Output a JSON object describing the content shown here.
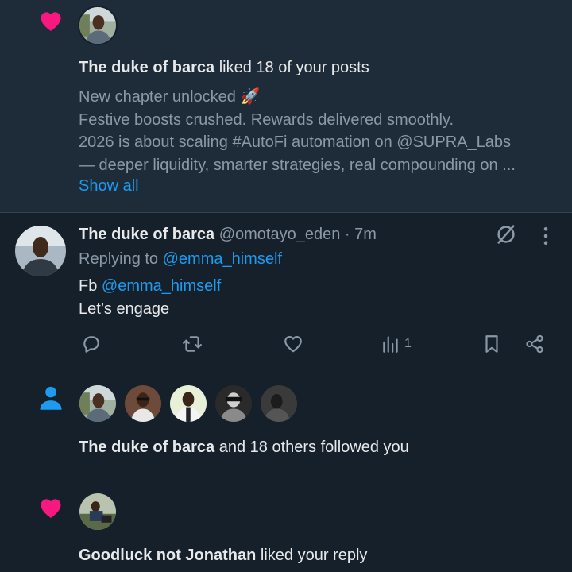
{
  "notifications": [
    {
      "type": "like",
      "actor": "The duke of barca",
      "text": " liked 18 of your posts",
      "snippet_lines": [
        "New chapter unlocked 🚀",
        "Festive boosts crushed. Rewards delivered smoothly.",
        "2026 is about scaling #AutoFi automation on @SUPRA_Labs",
        "— deeper liquidity, smarter strategies, real compounding on ..."
      ],
      "show_all": "Show all"
    },
    {
      "type": "follow",
      "actor": "The duke of barca",
      "text": " and 18 others followed you"
    },
    {
      "type": "like",
      "actor": "Goodluck not Jonathan",
      "text": " liked your reply"
    }
  ],
  "tweet": {
    "name": "The duke of barca",
    "handle_time": " @omotayo_eden · 7m",
    "replying_prefix": "Replying to ",
    "replying_to": "@emma_himself",
    "body_prefix": "Fb ",
    "body_mention": "@emma_himself",
    "body_line2": "Let’s engage",
    "views": "1"
  },
  "icons": {
    "heart": "heart-icon",
    "person": "person-icon",
    "grok": "grok-icon",
    "more": "more-icon",
    "reply": "reply-icon",
    "retweet": "retweet-icon",
    "like": "like-icon",
    "views": "views-icon",
    "bookmark": "bookmark-icon",
    "share": "share-icon"
  },
  "colors": {
    "background": "#15202b",
    "highlight_background": "#1e2c3a",
    "accent": "#1d9bf0",
    "heart": "#f91880",
    "secondary_text": "#8b98a5"
  }
}
